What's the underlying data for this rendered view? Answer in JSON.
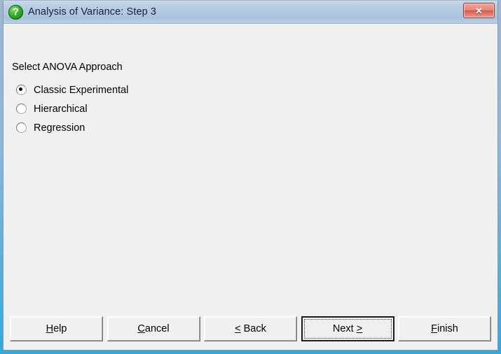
{
  "window": {
    "title": "Analysis of Variance: Step 3",
    "title_icon": "question-mark-icon",
    "close_label": "✕",
    "frame_color": "#8fb8d8",
    "titlebar_color": "#b2c8df",
    "body_color": "#f0f0f0"
  },
  "main": {
    "group_label": "Select ANOVA Approach",
    "options": [
      {
        "label": "Classic Experimental",
        "selected": true
      },
      {
        "label": "Hierarchical",
        "selected": false
      },
      {
        "label": "Regression",
        "selected": false
      }
    ]
  },
  "buttons": [
    {
      "name": "help-button",
      "accel": "H",
      "pre": "",
      "post": "elp",
      "default": false
    },
    {
      "name": "cancel-button",
      "accel": "C",
      "pre": "",
      "post": "ancel",
      "default": false
    },
    {
      "name": "back-button",
      "accel": "<",
      "pre": "",
      "post": " Back",
      "default": false
    },
    {
      "name": "next-button",
      "accel": ">",
      "pre": "Next ",
      "post": "",
      "default": true
    },
    {
      "name": "finish-button",
      "accel": "F",
      "pre": "",
      "post": "inish",
      "default": false
    }
  ]
}
